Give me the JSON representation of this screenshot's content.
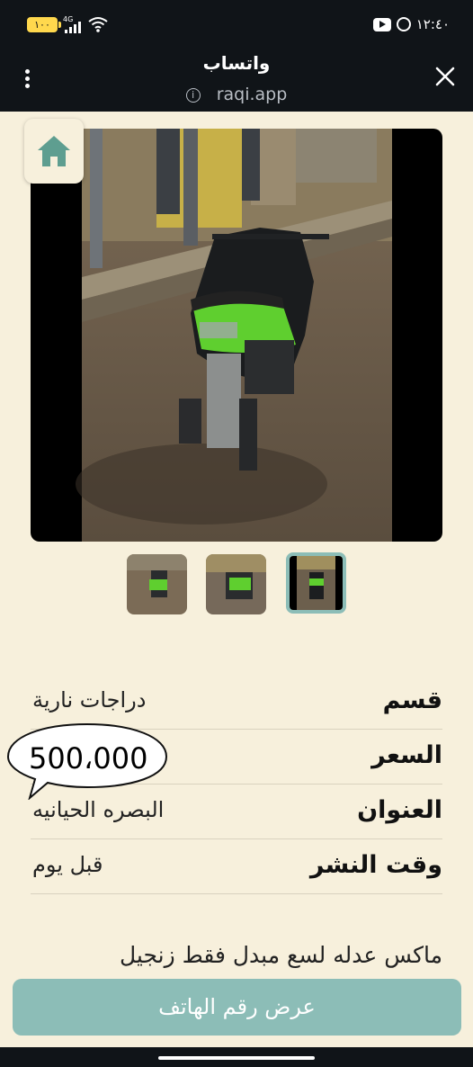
{
  "status_bar": {
    "battery": "١٠٠",
    "network": "4G",
    "time": "١٢:٤٠"
  },
  "browser": {
    "title": "واتساب",
    "url": "raqi.app"
  },
  "listing": {
    "rows": [
      {
        "label": "قسم",
        "value": "دراجات نارية"
      },
      {
        "label": "السعر",
        "value": ""
      },
      {
        "label": "العنوان",
        "value": "البصره الحيانيه"
      },
      {
        "label": "وقت النشر",
        "value": "قبل يوم"
      }
    ],
    "price_bubble": "500،000",
    "description": "ماكس عدله لسع مبدل فقط زنجيل"
  },
  "cta": {
    "label": "عرض رقم الهاتف"
  },
  "colors": {
    "background": "#F7F0DC",
    "accent": "#8CBDB7",
    "bar": "#101418"
  },
  "icons": [
    "home-icon",
    "close-icon",
    "menu-dots-icon",
    "info-icon"
  ]
}
